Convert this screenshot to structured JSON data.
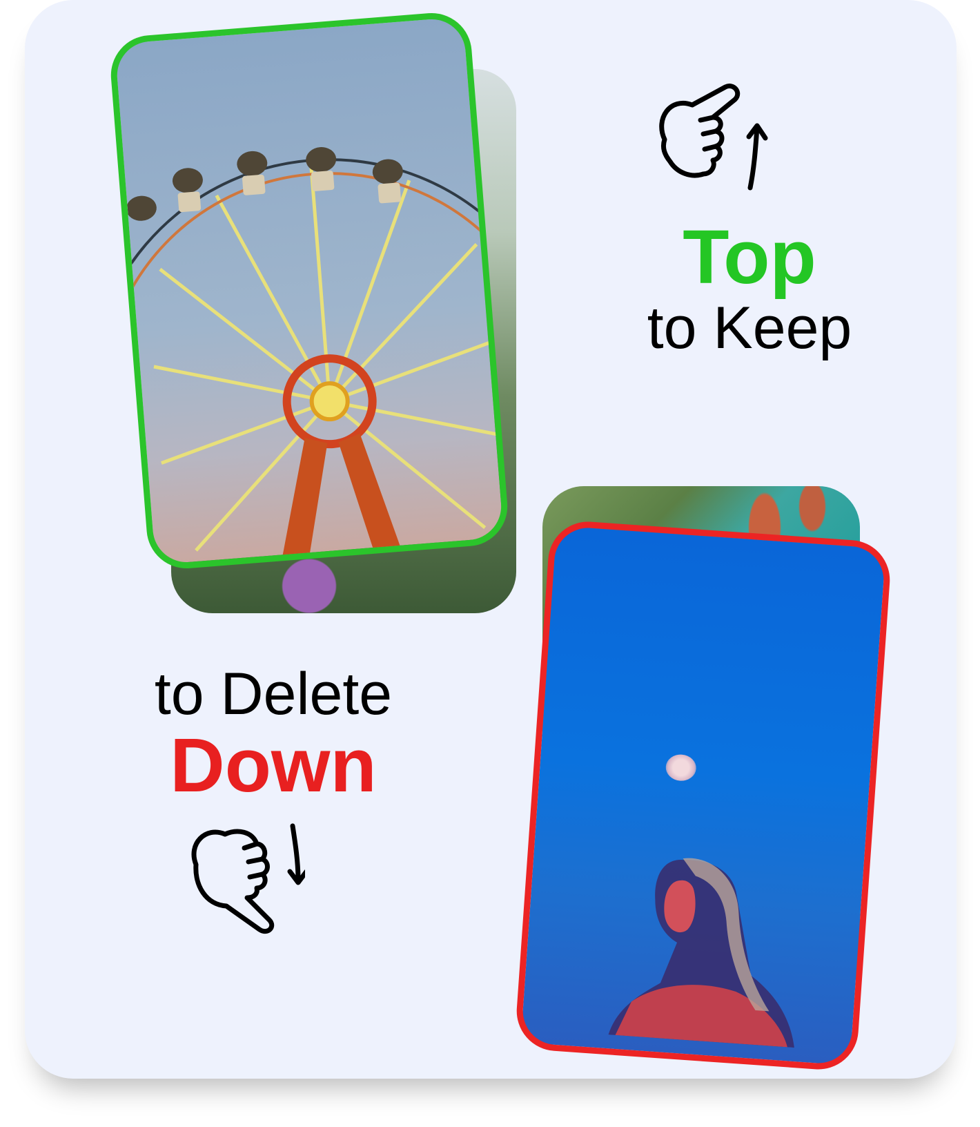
{
  "keep": {
    "strong": "Top",
    "label": "to Keep",
    "color": "#24c624"
  },
  "delete": {
    "label": "to Delete",
    "strong": "Down",
    "color": "#e82020"
  },
  "icons": {
    "swipe_up": "pointing-hand-swipe-up-icon",
    "swipe_down": "pointing-hand-swipe-down-icon"
  },
  "colors": {
    "panel_background": "#eef2fd",
    "keep_border": "#2bc42b",
    "delete_border": "#ec2424"
  }
}
